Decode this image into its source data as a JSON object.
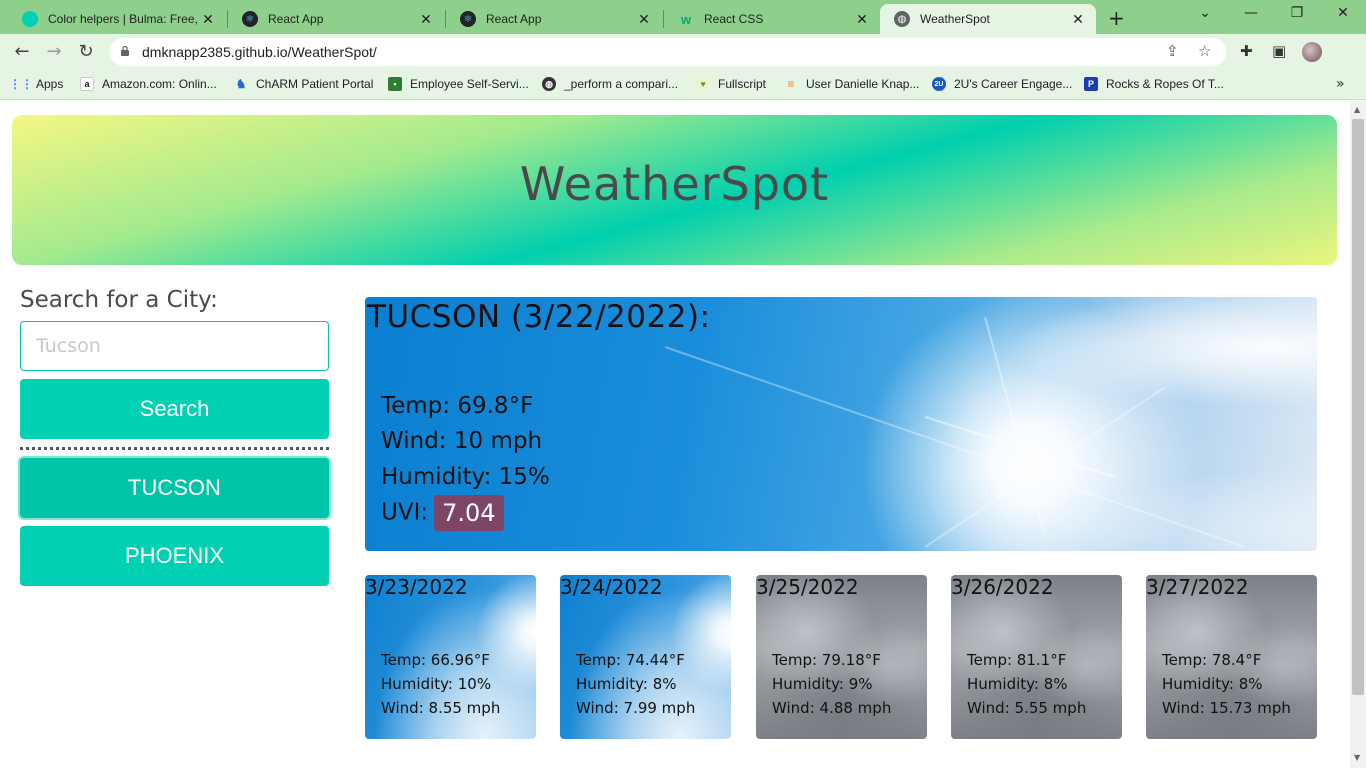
{
  "browser": {
    "tabs": [
      {
        "title": "Color helpers | Bulma: Free, o",
        "icon": "bulma-icon",
        "color": "#00d1b2"
      },
      {
        "title": "React App",
        "icon": "react-icon",
        "color": "#20232a"
      },
      {
        "title": "React App",
        "icon": "react-icon",
        "color": "#20232a"
      },
      {
        "title": "React CSS",
        "icon": "w3schools-icon",
        "color": "#04aa6d"
      },
      {
        "title": "WeatherSpot",
        "icon": "globe-icon",
        "color": "#5f6368"
      }
    ],
    "url": "dmknapp2385.github.io/WeatherSpot/",
    "bookmarks": [
      {
        "label": "Apps"
      },
      {
        "label": "Amazon.com: Onlin..."
      },
      {
        "label": "ChARM Patient Portal"
      },
      {
        "label": "Employee Self-Servi..."
      },
      {
        "label": "_perform a compari..."
      },
      {
        "label": "Fullscript"
      },
      {
        "label": "User Danielle Knap..."
      },
      {
        "label": "2U's Career Engage..."
      },
      {
        "label": "Rocks & Ropes Of T..."
      }
    ]
  },
  "app": {
    "title": "WeatherSpot",
    "search": {
      "label": "Search for a City:",
      "placeholder": "Tucson",
      "value": "",
      "button": "Search"
    },
    "cities": [
      "TUCSON",
      "PHOENIX"
    ],
    "current": {
      "title": "TUCSON (3/22/2022):",
      "temp": "Temp: 69.8°F",
      "wind": "Wind: 10 mph",
      "humidity": "Humidity: 15%",
      "uvi_label": "UVI:",
      "uvi": "7.04",
      "uvi_color": "#7d4565"
    },
    "forecast": [
      {
        "date": "3/23/2022",
        "temp": "Temp: 66.96°F",
        "humidity": "Humidity: 10%",
        "wind": "Wind: 8.55 mph",
        "sky": "sunny"
      },
      {
        "date": "3/24/2022",
        "temp": "Temp: 74.44°F",
        "humidity": "Humidity: 8%",
        "wind": "Wind: 7.99 mph",
        "sky": "sunny"
      },
      {
        "date": "3/25/2022",
        "temp": "Temp: 79.18°F",
        "humidity": "Humidity: 9%",
        "wind": "Wind: 4.88 mph",
        "sky": "cloudy"
      },
      {
        "date": "3/26/2022",
        "temp": "Temp: 81.1°F",
        "humidity": "Humidity: 8%",
        "wind": "Wind: 5.55 mph",
        "sky": "cloudy"
      },
      {
        "date": "3/27/2022",
        "temp": "Temp: 78.4°F",
        "humidity": "Humidity: 8%",
        "wind": "Wind: 15.73 mph",
        "sky": "cloudy"
      }
    ],
    "colors": {
      "accent": "#00d1b2",
      "header_text": "#4a4a4a"
    }
  }
}
